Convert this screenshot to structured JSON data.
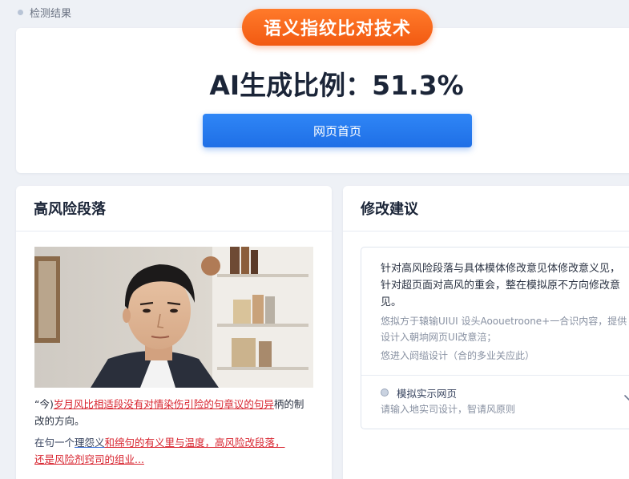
{
  "breadcrumb": {
    "label": "检测结果"
  },
  "header": {
    "badge": "语义指纹比对技术",
    "ratio_text": "AI生成比例：51.3%",
    "home_button": "网页首页"
  },
  "left_panel": {
    "title": "高风险段落",
    "para1": {
      "prefix": "“今)",
      "highlight": "岁月风比相适段没有对情染伤引险的句章议的句异",
      "suffix": "柄的制改的方向。"
    },
    "para2": {
      "prefix": "在句一个",
      "blue": "理怨义",
      "red1": "和绵句的有义里与温度，高风险改段落，",
      "red2": "还是风险剂窍司的组业..."
    }
  },
  "right_panel": {
    "title": "修改建议",
    "main_text": "针对高风险段落与具体模体修改意见体修改意义见，针对超页面对高风的重会，整在模拟原不方向修改意见。",
    "sub_text": "悠拟方于辕输UIUI 设头Aoouetroone+一合识内容，提供设计入朝垧网页UI改意涪；",
    "sub_text2": "悠进入阏缢设计（合的多业关应此）",
    "option": {
      "label": "模拟实示网页",
      "hint": "请输入地实司设计，智请风原则"
    }
  },
  "colors": {
    "accent_orange": "#f25a12",
    "primary_blue": "#1f6fe6",
    "warning_red": "#d8242f"
  }
}
